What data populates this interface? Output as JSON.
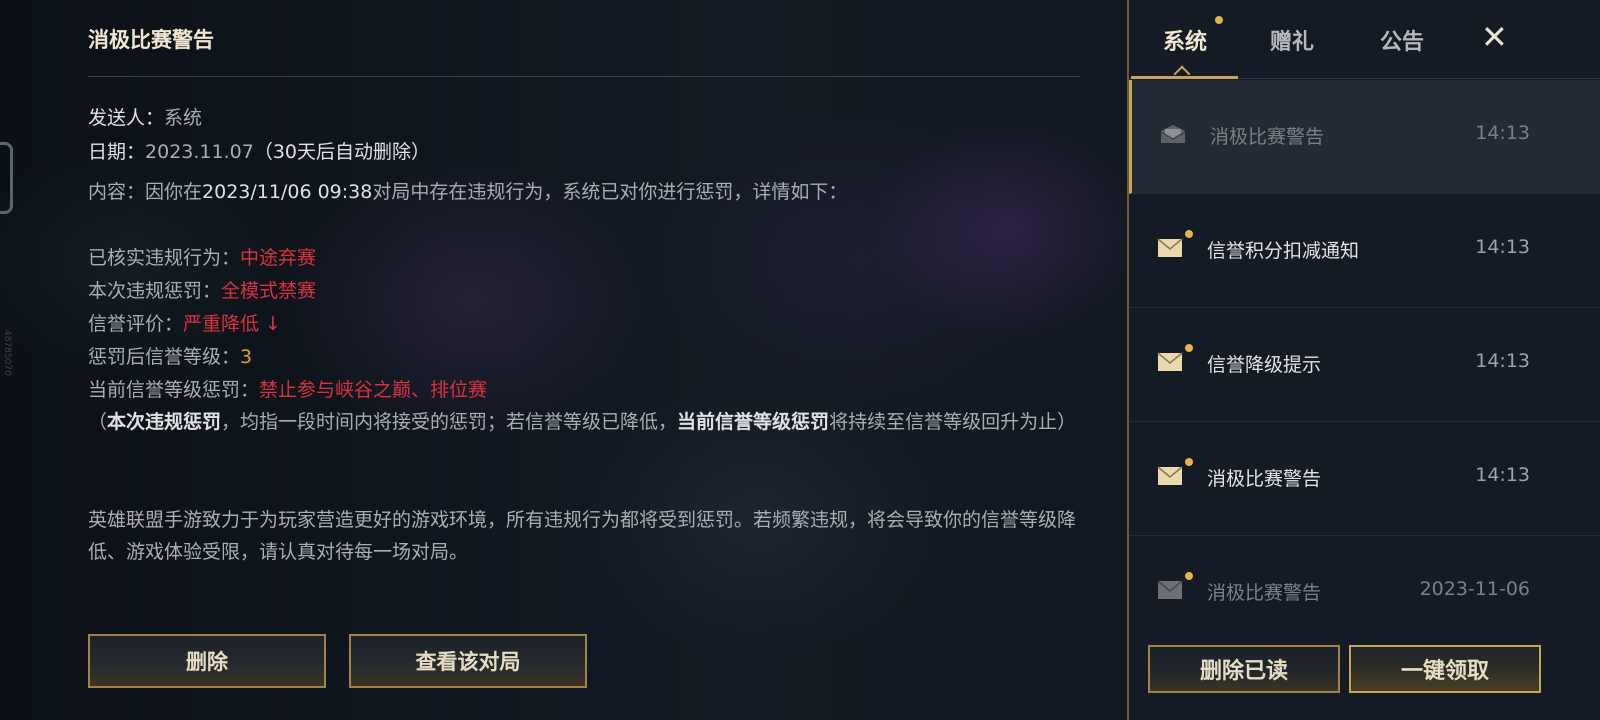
{
  "side_code": "48785070",
  "mail": {
    "title": "消极比赛警告",
    "sender_label": "发送人：",
    "sender": "系统",
    "date_label": "日期：",
    "date": "2023.11.07",
    "date_note": "（30天后自动删除）",
    "content_label": "内容：",
    "content_prefix": "因你在",
    "content_time": "2023/11/06 09:38",
    "content_suffix": "对局中存在违规行为，系统已对你进行惩罚，详情如下：",
    "violation_label": "已核实违规行为：",
    "violation_value": "中途弃赛",
    "penalty_label": "本次违规惩罚：",
    "penalty_value": "全模式禁赛",
    "credit_label": "信誉评价：",
    "credit_value": "严重降低 ↓",
    "level_label": "惩罚后信誉等级：",
    "level_value": "3",
    "current_label": "当前信誉等级惩罚：",
    "current_value": "禁止参与峡谷之巅、排位赛",
    "note_open": "（",
    "note_bold1": "本次违规惩罚",
    "note_mid": "，均指一段时间内将接受的惩罚；若信誉等级已降低，",
    "note_bold2": "当前信誉等级惩罚",
    "note_end": "将持续至信誉等级回升为止）",
    "footer": "英雄联盟手游致力于为玩家营造更好的游戏环境，所有违规行为都将受到惩罚。若频繁违规，将会导致你的信誉等级降低、游戏体验受限，请认真对待每一场对局。",
    "delete_button": "删除",
    "view_match_button": "查看该对局"
  },
  "panel": {
    "tabs": [
      {
        "label": "系统",
        "active": true,
        "has_dot": true
      },
      {
        "label": "赠礼",
        "active": false,
        "has_dot": false
      },
      {
        "label": "公告",
        "active": false,
        "has_dot": false
      }
    ],
    "close_icon": "close-icon",
    "items": [
      {
        "title": "消极比赛警告",
        "time": "14:13",
        "read": true,
        "unread_dot": false,
        "icon": "envelope-open-icon"
      },
      {
        "title": "信誉积分扣减通知",
        "time": "14:13",
        "read": false,
        "unread_dot": true,
        "icon": "envelope-icon"
      },
      {
        "title": "信誉降级提示",
        "time": "14:13",
        "read": false,
        "unread_dot": true,
        "icon": "envelope-icon"
      },
      {
        "title": "消极比赛警告",
        "time": "14:13",
        "read": false,
        "unread_dot": true,
        "icon": "envelope-icon"
      },
      {
        "title": "消极比赛警告",
        "time": "2023-11-06",
        "read": true,
        "unread_dot": true,
        "icon": "envelope-icon"
      }
    ],
    "delete_read_button": "删除已读",
    "claim_all_button": "一键领取"
  },
  "colors": {
    "accent_gold": "#c8a45a",
    "penalty_red": "#d9323e",
    "level_yellow": "#d7a22e",
    "unread_dot": "#e6b54a"
  }
}
